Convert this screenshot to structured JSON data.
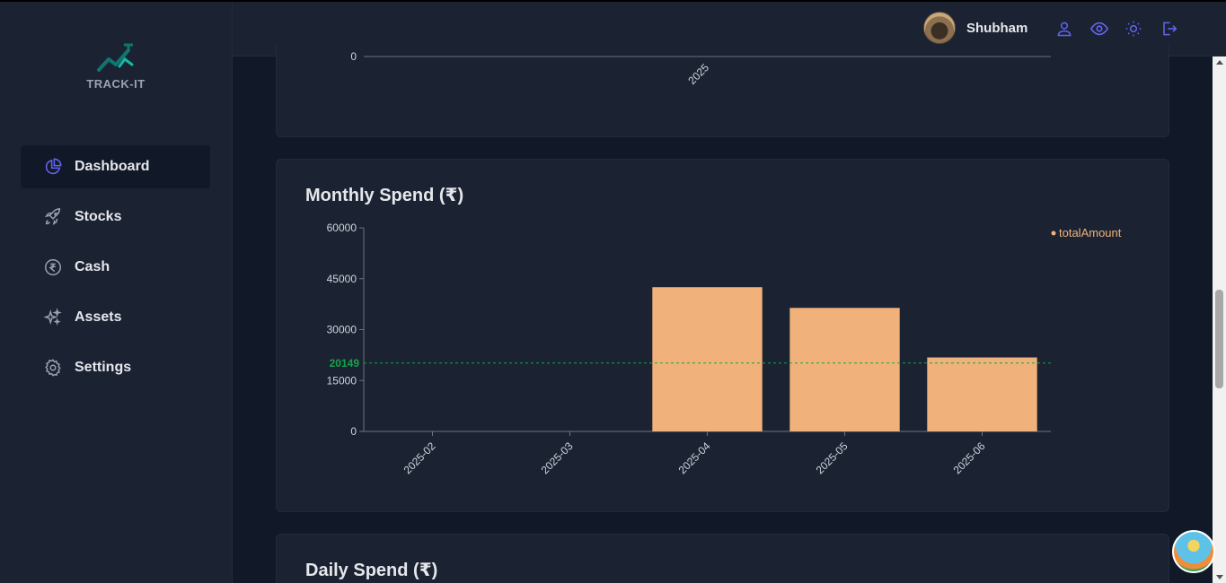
{
  "app": {
    "name": "TRACK-IT"
  },
  "sidebar": {
    "items": [
      {
        "label": "Dashboard",
        "icon": "pie-chart-icon",
        "active": true
      },
      {
        "label": "Stocks",
        "icon": "rocket-icon",
        "active": false
      },
      {
        "label": "Cash",
        "icon": "rupee-circle-icon",
        "active": false
      },
      {
        "label": "Assets",
        "icon": "sparkles-icon",
        "active": false
      },
      {
        "label": "Settings",
        "icon": "gear-icon",
        "active": false
      }
    ]
  },
  "header": {
    "username": "Shubham",
    "icons": [
      "user-icon",
      "eye-icon",
      "sun-icon",
      "logout-icon"
    ],
    "icon_color": "#6366f1"
  },
  "top_chart_fragment": {
    "y_tick": "0",
    "x_tick": "2025"
  },
  "monthly_card": {
    "title": "Monthly Spend (₹)"
  },
  "daily_card": {
    "title": "Daily Spend (₹)"
  },
  "chart_data": {
    "type": "bar",
    "title": "Monthly Spend (₹)",
    "categories": [
      "2025-02",
      "2025-03",
      "2025-04",
      "2025-05",
      "2025-06"
    ],
    "series": [
      {
        "name": "totalAmount",
        "values": [
          0,
          0,
          42500,
          36400,
          21800
        ],
        "color": "#f0b27a"
      }
    ],
    "yticks": [
      "0",
      "15000",
      "30000",
      "45000",
      "60000"
    ],
    "ylim": [
      0,
      60000
    ],
    "reference_line": {
      "value": 20149,
      "label": "20149",
      "color": "#16a34a"
    },
    "legend": {
      "position": "top-right",
      "label": "totalAmount"
    },
    "grid": false
  },
  "colors": {
    "accent": "#6366f1",
    "bar": "#f0b27a",
    "reference": "#16a34a",
    "card_bg": "#1b2232",
    "page_bg": "#111827"
  }
}
